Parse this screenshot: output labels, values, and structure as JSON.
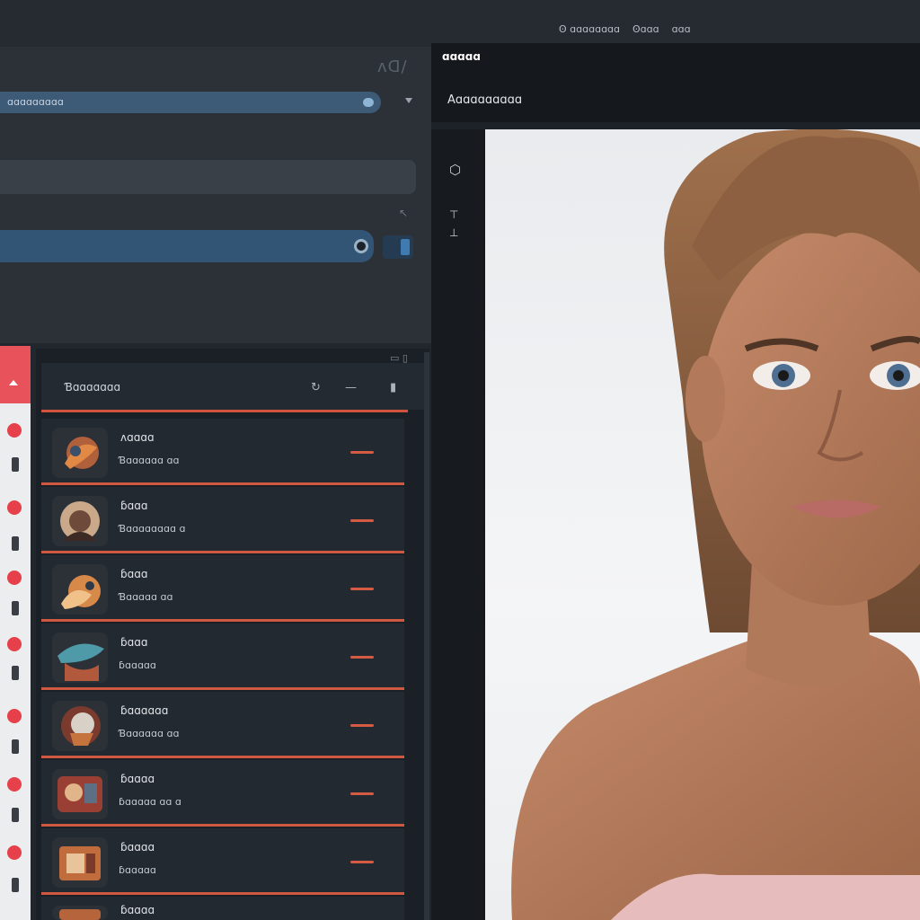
{
  "topbar": {
    "menu": [
      "Ꙩ ɑɑɑɑɑɑɑɑ",
      "Ꙩɑɑɑ",
      "ɑɑɑ"
    ]
  },
  "settings": {
    "corner_label": "ᴧᗡ/",
    "field_a_label": "ɑɑɑɑɑɑɑɑɑ",
    "small_mark": "↖"
  },
  "list": {
    "title": "Ɓɑɑɑɑɑɑɑ",
    "items": [
      {
        "name": "ᴧɑɑɑɑ",
        "sub": "Ɓɑɑɑɑɑɑ ɑɑ"
      },
      {
        "name": "ɓɑɑɑ",
        "sub": "Ɓɑɑɑɑɑɑɑɑ ɑ"
      },
      {
        "name": "ɓɑɑɑ",
        "sub": "Ɓɑɑɑɑɑ ɑɑ"
      },
      {
        "name": "ɓɑɑɑ",
        "sub": "ɓɑɑɑɑɑ"
      },
      {
        "name": "ɓɑɑɑɑɑɑ",
        "sub": "Ɓɑɑɑɑɑɑ ɑɑ"
      },
      {
        "name": "ɓɑɑɑɑ",
        "sub": "ɓɑɑɑɑɑ ɑɑ ɑ"
      },
      {
        "name": "ɓɑɑɑɑ",
        "sub": "ɓɑɑɑɑɑ"
      },
      {
        "name": "ɓɑɑɑɑ",
        "sub": ""
      }
    ]
  },
  "viewer": {
    "tab_label": "ɑɑɑɑɑ",
    "title": "Aɑɑɑɑɑɑɑɑɑ"
  },
  "colors": {
    "accent": "#d1533e",
    "field_blue": "#3d5a77",
    "rail_red": "#e8525a"
  },
  "icons": [
    "refresh-icon",
    "minus-icon",
    "pin-icon",
    "cube-icon",
    "ruler-icon",
    "chevron-down-icon"
  ]
}
